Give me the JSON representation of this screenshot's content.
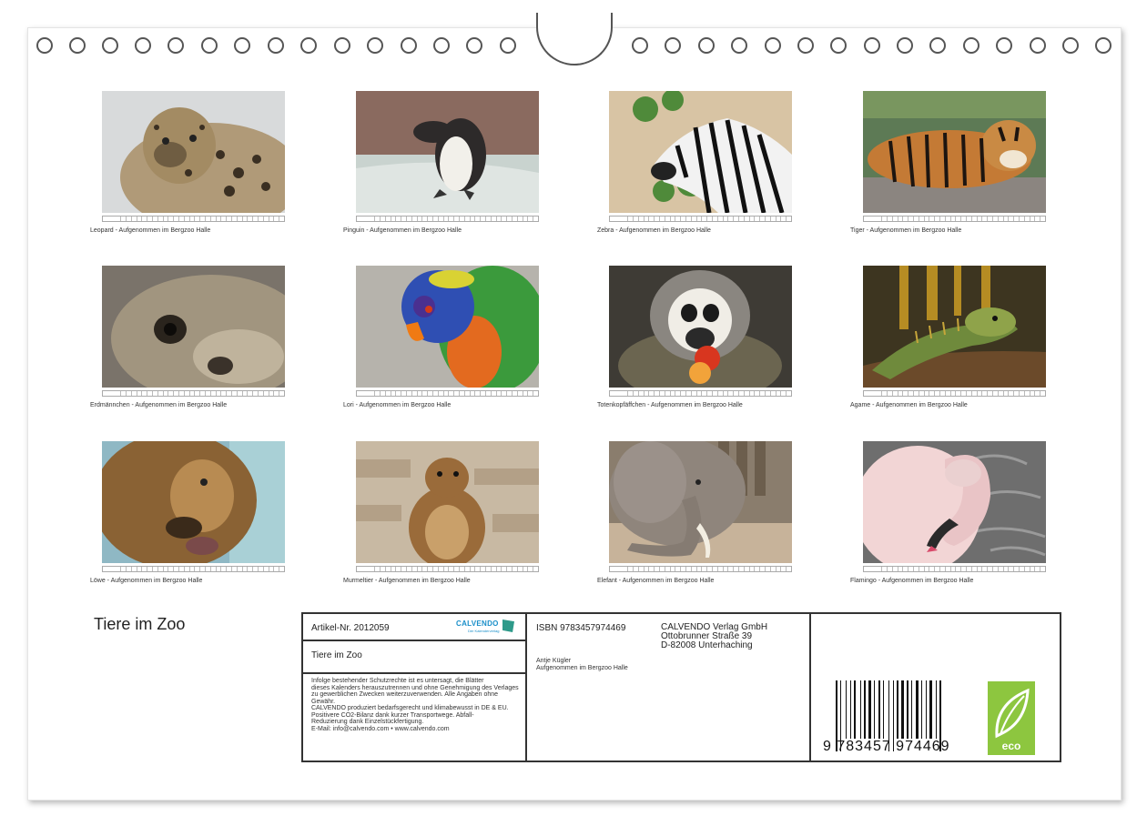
{
  "calendar": {
    "title": "Tiere im Zoo",
    "images": [
      {
        "caption": "Leopard - Aufgenommen im Bergzoo Halle"
      },
      {
        "caption": "Pinguin - Aufgenommen im Bergzoo Halle"
      },
      {
        "caption": "Zebra - Aufgenommen im Bergzoo Halle"
      },
      {
        "caption": "Tiger - Aufgenommen im Bergzoo Halle"
      },
      {
        "caption": "Erdmännchen - Aufgenommen im Bergzoo Halle"
      },
      {
        "caption": "Lori - Aufgenommen im Bergzoo Halle"
      },
      {
        "caption": "Totenkopfäffchen - Aufgenommen im Bergzoo Halle"
      },
      {
        "caption": "Agame - Aufgenommen im Bergzoo Halle"
      },
      {
        "caption": "Löwe - Aufgenommen im Bergzoo Halle"
      },
      {
        "caption": "Murmeltier - Aufgenommen im Bergzoo Halle"
      },
      {
        "caption": "Elefant - Aufgenommen im Bergzoo Halle"
      },
      {
        "caption": "Flamingo - Aufgenommen im Bergzoo Halle"
      }
    ]
  },
  "info": {
    "article": "Artikel-Nr. 2012059",
    "logo_text": "CALVENDO",
    "logo_sub": "Der Kalenderverlag",
    "title": "Tiere im Zoo",
    "legal": [
      "Infolge bestehender Schutzrechte ist es untersagt, die Blätter",
      "dieses Kalenders herauszutrennen und ohne Genehmigung des Verlages",
      "zu gewerblichen Zwecken weiterzuverwenden. Alle Angaben ohne",
      "Gewähr.",
      "CALVENDO produziert bedarfsgerecht und klimabewusst in DE & EU.",
      "Positivere CO2-Bilanz dank kurzer Transportwege. Abfall-",
      "Reduzierung dank Einzelstückfertigung.",
      "E-Mail: info@calvendo.com • www.calvendo.com"
    ],
    "isbn": "ISBN 9783457974469",
    "publisher": [
      "CALVENDO Verlag GmbH",
      "Ottobrunner Straße 39",
      "D-82008 Unterhaching"
    ],
    "author": "Antje Kügler",
    "author_note": "Aufgenommen im Bergzoo Halle",
    "barcode_number": "9 783457 974469",
    "eco_label": "eco"
  },
  "colors": {
    "calvendo_blue": "#1a8fc9",
    "eco_green": "#8dc63f"
  }
}
